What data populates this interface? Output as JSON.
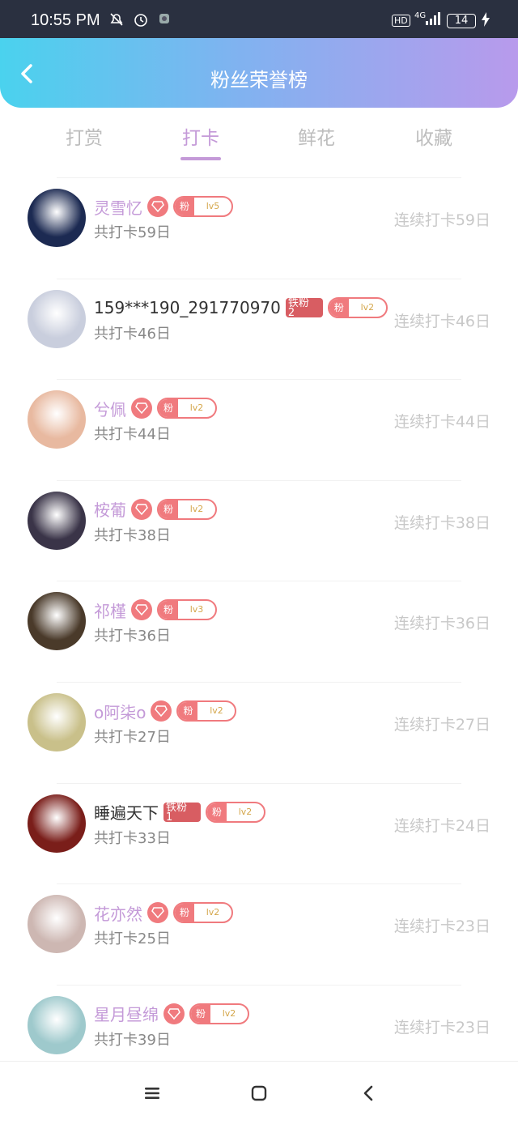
{
  "status_bar": {
    "time": "10:55 PM",
    "battery": "14",
    "network": "4G",
    "hd": "HD"
  },
  "header": {
    "title": "粉丝荣誉榜"
  },
  "tabs": [
    {
      "label": "打赏"
    },
    {
      "label": "打卡"
    },
    {
      "label": "鲜花"
    },
    {
      "label": "收藏"
    }
  ],
  "active_tab": "打卡",
  "fans": [
    {
      "name": "灵雪忆",
      "gem": true,
      "iron": null,
      "fan_badge": "粉",
      "level": "lv5",
      "total": "共打卡59日",
      "streak": "连续打卡59日",
      "name_color": "#c49ad8",
      "avatar_color": "#1c2a52"
    },
    {
      "name": "159***190_291770970",
      "gem": false,
      "iron": "铁粉\n2",
      "fan_badge": "粉",
      "level": "lv2",
      "total": "共打卡46日",
      "streak": "连续打卡46日",
      "name_color": "#333333",
      "avatar_color": "#c9cedd"
    },
    {
      "name": "兮佩",
      "gem": true,
      "iron": null,
      "fan_badge": "粉",
      "level": "lv2",
      "total": "共打卡44日",
      "streak": "连续打卡44日",
      "name_color": "#c49ad8",
      "avatar_color": "#e8b9a0"
    },
    {
      "name": "桉葡",
      "gem": true,
      "iron": null,
      "fan_badge": "粉",
      "level": "lv2",
      "total": "共打卡38日",
      "streak": "连续打卡38日",
      "name_color": "#c49ad8",
      "avatar_color": "#3a3448"
    },
    {
      "name": "祁槿",
      "gem": true,
      "iron": null,
      "fan_badge": "粉",
      "level": "lv3",
      "total": "共打卡36日",
      "streak": "连续打卡36日",
      "name_color": "#c49ad8",
      "avatar_color": "#4a3a2a"
    },
    {
      "name": "o阿柒o",
      "gem": true,
      "iron": null,
      "fan_badge": "粉",
      "level": "lv2",
      "total": "共打卡27日",
      "streak": "连续打卡27日",
      "name_color": "#c49ad8",
      "avatar_color": "#c9c08a"
    },
    {
      "name": "睡遍天下",
      "gem": false,
      "iron": "铁粉\n1",
      "fan_badge": "粉",
      "level": "lv2",
      "total": "共打卡33日",
      "streak": "连续打卡24日",
      "name_color": "#333333",
      "avatar_color": "#7a1e1a"
    },
    {
      "name": "花亦然",
      "gem": true,
      "iron": null,
      "fan_badge": "粉",
      "level": "lv2",
      "total": "共打卡25日",
      "streak": "连续打卡23日",
      "name_color": "#c49ad8",
      "avatar_color": "#cdb7b2"
    },
    {
      "name": "星月昼绵",
      "gem": true,
      "iron": null,
      "fan_badge": "粉",
      "level": "lv2",
      "total": "共打卡39日",
      "streak": "连续打卡23日",
      "name_color": "#c49ad8",
      "avatar_color": "#9ec9cc"
    }
  ],
  "colors": {
    "accent": "#c49ad8",
    "badge": "#f07a7e",
    "iron": "#d85d62"
  },
  "icons": {
    "back": "back-chevron-icon",
    "nav_menu": "menu-icon",
    "nav_home": "home-square-icon",
    "nav_back": "back-triangle-icon"
  }
}
